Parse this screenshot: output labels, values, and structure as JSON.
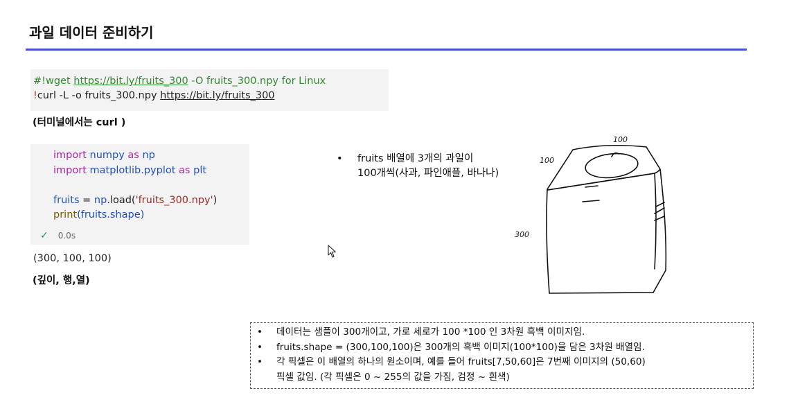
{
  "slide": {
    "title": "과일 데이터 준비하기"
  },
  "cell1": {
    "line1_prefix": "#!wget ",
    "line1_url": "https://bit.ly/fruits_300",
    "line1_suffix": " -O fruits_300.npy for Linux",
    "line2_bang": "!",
    "line2_cmd": "curl -L -o fruits_300.npy ",
    "line2_url": "https://bit.ly/fruits_300"
  },
  "note_terminal": "(터미널에서는 curl )",
  "cell2": {
    "l1_import": "import",
    "l1_mod": "numpy",
    "l1_as": "as",
    "l1_alias": "np",
    "l2_import": "import",
    "l2_mod": "matplotlib.pyplot",
    "l2_as": "as",
    "l2_alias": "plt",
    "l3_var": "fruits",
    "l3_eq": " = ",
    "l3_np": "np",
    "l3_load": ".load(",
    "l3_str": "'fruits_300.npy'",
    "l3_close": ")",
    "l4_print": "print",
    "l4_arg": "(fruits.shape)",
    "exec_time": "0.0s"
  },
  "output": "(300, 100, 100)",
  "note_dims": "(깊이, 행,열)",
  "bullet_top": {
    "dot": "•",
    "line1": "fruits 배열에 3개의 과일이",
    "line2": "100개씩(사과, 파인애플, 바나나)"
  },
  "sketch_labels": {
    "top": "100",
    "left_top": "100",
    "side": "300"
  },
  "info_box": {
    "dot": "•",
    "items": [
      "데이터는 샘플이 300개이고, 가로 세로가 100 *100 인 3차원 흑백 이미지임.",
      "fruits.shape = (300,100,100)은 300개의 흑백 이미지(100*100)을 담은 3차원 배열임.",
      "각 픽셀은 이 배열의 하나의 원소이며, 예를 들어 fruits[7,50,60]은 7번째 이미지의 (50,60)",
      "픽셀 값임. (각 픽셀은 0 ~ 255의 값을 가짐, 검정 ~ 흰색)"
    ]
  },
  "colors": {
    "title_rule": "#4a4fd1",
    "cell_bg": "#f3f3f3",
    "keyword": "#a626a4",
    "identifier": "#1f4fbf",
    "comment": "#2e8b2e"
  }
}
